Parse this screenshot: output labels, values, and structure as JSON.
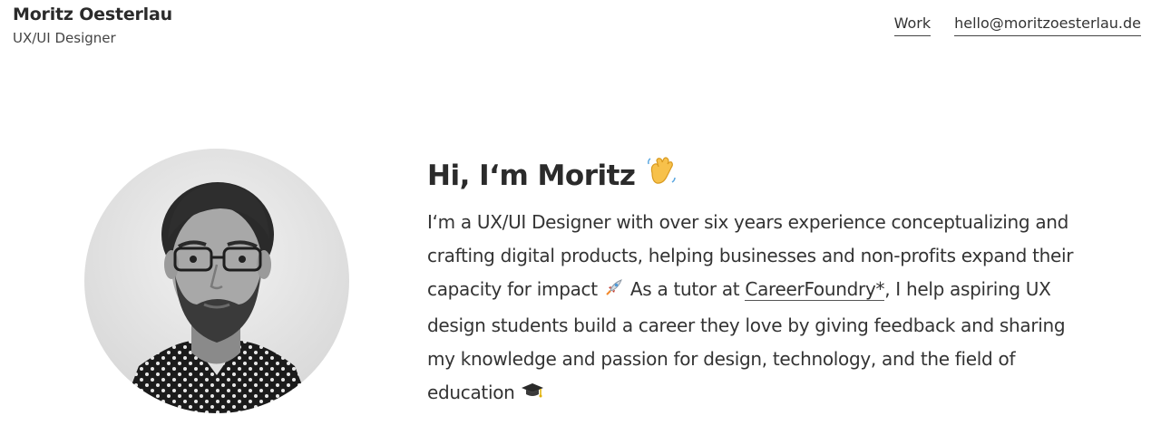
{
  "header": {
    "name": "Moritz Oesterlau",
    "role": "UX/UI Designer"
  },
  "nav": {
    "work_label": "Work",
    "email_label": "hello@moritzoesterlau.de"
  },
  "intro": {
    "heading": "Hi, I‘m Moritz",
    "heading_icon": "waving-hand-icon",
    "bio_part1": "I‘m a UX/UI Designer with over six years experience conceptualizing and crafting digital products, helping businesses and non-profits expand their capacity for impact",
    "bio_icon_1": "rocket-icon",
    "bio_part2": " As a tutor at ",
    "tutor_link_label": "CareerFoundry*",
    "bio_part3": ", I help aspiring UX design students build a career they love by giving feedback and sharing my knowledge and passion for design, technology, and the field of education",
    "bio_icon_2": "graduation-cap-icon"
  },
  "colors": {
    "text": "#2b2b2b",
    "background": "#ffffff"
  }
}
